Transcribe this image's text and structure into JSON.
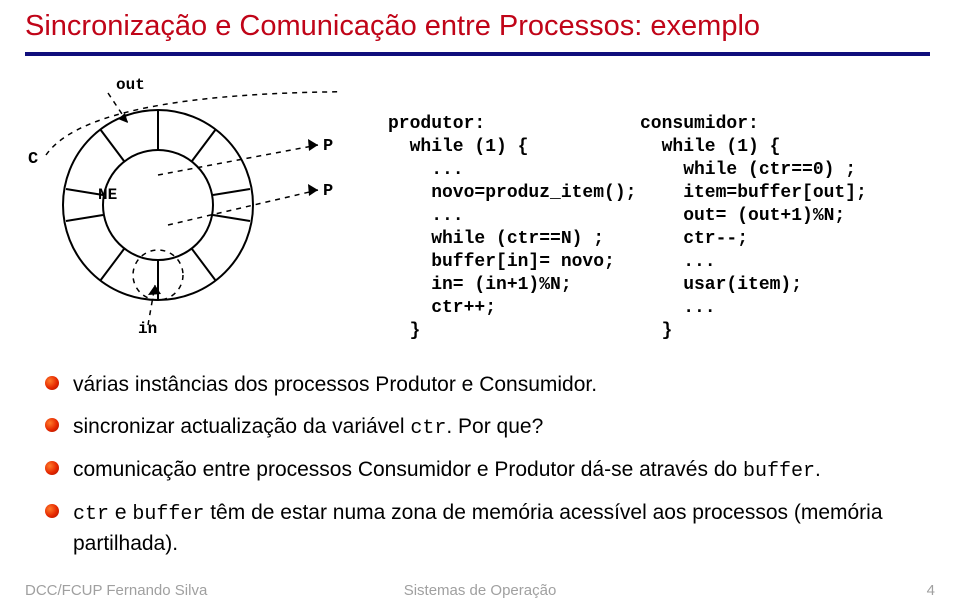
{
  "title": "Sincronização e Comunicação entre Processos: exemplo",
  "diagram": {
    "out": "out",
    "in": "in",
    "C": "C",
    "NE": "NE",
    "P1": "P",
    "P2": "P"
  },
  "code": {
    "produtor": "produtor:\n  while (1) {\n    ...\n    novo=produz_item();\n    ...\n    while (ctr==N) ;\n    buffer[in]= novo;\n    in= (in+1)%N;\n    ctr++;\n  }",
    "consumidor": "consumidor:\n  while (1) {\n    while (ctr==0) ;\n    item=buffer[out];\n    out= (out+1)%N;\n    ctr--;\n    ...\n    usar(item);\n    ...\n  }"
  },
  "bullets": {
    "b1": "várias instâncias dos processos Produtor e Consumidor.",
    "b2_a": "sincronizar actualização da variável ",
    "b2_mono": "ctr",
    "b2_b": ". Por que?",
    "b3_a": "comunicação entre processos Consumidor e Produtor dá-se através do ",
    "b3_mono": "buffer",
    "b3_b": ".",
    "b4_a": "ctr",
    "b4_b": " e ",
    "b4_c": "buffer",
    "b4_d": " têm de estar numa zona de memória acessível aos processos (memória partilhada)."
  },
  "footer": {
    "left": "DCC/FCUP Fernando Silva",
    "center": "Sistemas de Operação",
    "right": "4"
  }
}
